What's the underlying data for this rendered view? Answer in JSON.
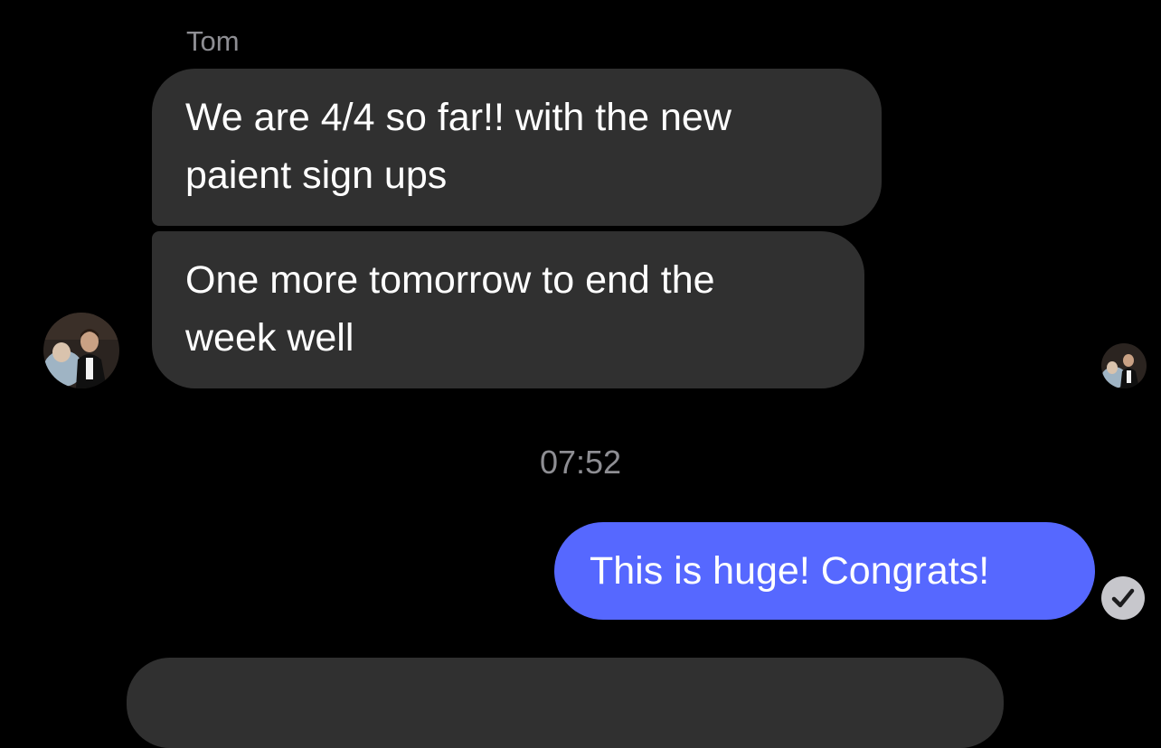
{
  "conversation": {
    "sender_name": "Tom",
    "messages_in": [
      {
        "line1": "We are 4/4 so far!! with the new",
        "line2": "paient sign ups"
      },
      {
        "line1": "One more tomorrow to end the",
        "line2": "week well"
      }
    ],
    "timestamp": "07:52",
    "message_out": "This is huge! Congrats!"
  },
  "colors": {
    "background": "#000000",
    "incoming_bubble": "#303030",
    "outgoing_bubble": "#5668ff",
    "secondary_text": "#8e8e93",
    "status_icon_bg": "#c7c7cc"
  },
  "icons": {
    "contact_avatar": "avatar-photo",
    "read_receipt_avatar": "avatar-photo",
    "delivery_status": "checkmark-icon"
  }
}
